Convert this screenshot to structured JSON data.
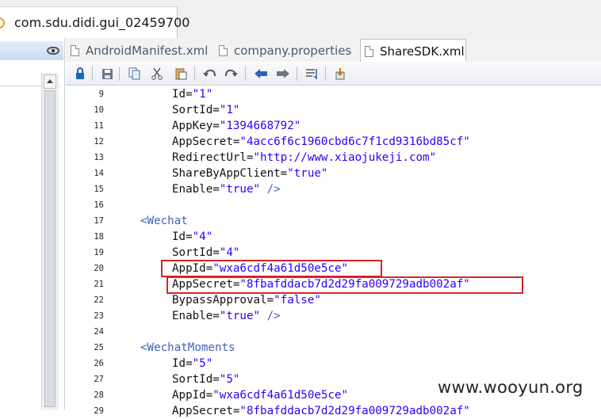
{
  "window_tab": {
    "title": "com.sdu.didi.gui_02459700"
  },
  "editor_tabs": [
    {
      "label": "AndroidManifest.xml",
      "active": false
    },
    {
      "label": "company.properties",
      "active": false
    },
    {
      "label": "ShareSDK.xml",
      "active": true
    }
  ],
  "toolbar": {
    "icons": [
      "lock-icon",
      "save-icon",
      "copy-icon",
      "cut-icon",
      "paste-icon",
      "undo-icon",
      "redo-icon",
      "back-arrow-icon",
      "forward-arrow-icon",
      "format-icon",
      "export-icon"
    ]
  },
  "code_lines": [
    {
      "n": "9",
      "parts": [
        {
          "t": "attr",
          "s": "Id="
        },
        {
          "t": "val",
          "s": "\"1\""
        }
      ]
    },
    {
      "n": "10",
      "parts": [
        {
          "t": "attr",
          "s": "SortId="
        },
        {
          "t": "val",
          "s": "\"1\""
        }
      ]
    },
    {
      "n": "11",
      "parts": [
        {
          "t": "attr",
          "s": "AppKey="
        },
        {
          "t": "val",
          "s": "\"1394668792\""
        }
      ]
    },
    {
      "n": "12",
      "parts": [
        {
          "t": "attr",
          "s": "AppSecret="
        },
        {
          "t": "val",
          "s": "\"4acc6f6c1960cbd6c7f1cd9316bd85cf\""
        }
      ]
    },
    {
      "n": "13",
      "parts": [
        {
          "t": "attr",
          "s": "RedirectUrl="
        },
        {
          "t": "val",
          "s": "\"http://www.xiaojukeji.com\""
        }
      ]
    },
    {
      "n": "14",
      "parts": [
        {
          "t": "attr",
          "s": "ShareByAppClient="
        },
        {
          "t": "val",
          "s": "\"true\""
        }
      ]
    },
    {
      "n": "15",
      "parts": [
        {
          "t": "attr",
          "s": "Enable="
        },
        {
          "t": "val",
          "s": "\"true\""
        },
        {
          "t": "tag",
          "s": " />"
        }
      ]
    },
    {
      "n": "16",
      "parts": []
    },
    {
      "n": "17",
      "indent": "tag",
      "parts": [
        {
          "t": "tag",
          "s": "<Wechat"
        }
      ]
    },
    {
      "n": "18",
      "parts": [
        {
          "t": "attr",
          "s": "Id="
        },
        {
          "t": "val",
          "s": "\"4\""
        }
      ]
    },
    {
      "n": "19",
      "parts": [
        {
          "t": "attr",
          "s": "SortId="
        },
        {
          "t": "val",
          "s": "\"4\""
        }
      ]
    },
    {
      "n": "20",
      "parts": [
        {
          "t": "attr",
          "s": "AppId="
        },
        {
          "t": "val",
          "s": "\"wxa6cdf4a61d50e5ce\""
        }
      ]
    },
    {
      "n": "21",
      "parts": [
        {
          "t": "attr",
          "s": "AppSecret="
        },
        {
          "t": "val",
          "s": "\"8fbafddacb7d2d29fa009729adb002af\""
        }
      ]
    },
    {
      "n": "22",
      "parts": [
        {
          "t": "attr",
          "s": "BypassApproval="
        },
        {
          "t": "val",
          "s": "\"false\""
        }
      ]
    },
    {
      "n": "23",
      "parts": [
        {
          "t": "attr",
          "s": "Enable="
        },
        {
          "t": "val",
          "s": "\"true\""
        },
        {
          "t": "tag",
          "s": " />"
        }
      ]
    },
    {
      "n": "24",
      "parts": []
    },
    {
      "n": "25",
      "indent": "tag",
      "parts": [
        {
          "t": "tag",
          "s": "<WechatMoments"
        }
      ]
    },
    {
      "n": "26",
      "parts": [
        {
          "t": "attr",
          "s": "Id="
        },
        {
          "t": "val",
          "s": "\"5\""
        }
      ]
    },
    {
      "n": "27",
      "parts": [
        {
          "t": "attr",
          "s": "SortId="
        },
        {
          "t": "val",
          "s": "\"5\""
        }
      ]
    },
    {
      "n": "28",
      "parts": [
        {
          "t": "attr",
          "s": "AppId="
        },
        {
          "t": "val",
          "s": "\"wxa6cdf4a61d50e5ce\""
        }
      ]
    },
    {
      "n": "29",
      "parts": [
        {
          "t": "attr",
          "s": "AppSecret="
        },
        {
          "t": "val",
          "s": "\"8fbafddacb7d2d29fa009729adb002af\""
        }
      ]
    }
  ],
  "highlight_color": "#d8232a",
  "watermark": "www.wooyun.org"
}
